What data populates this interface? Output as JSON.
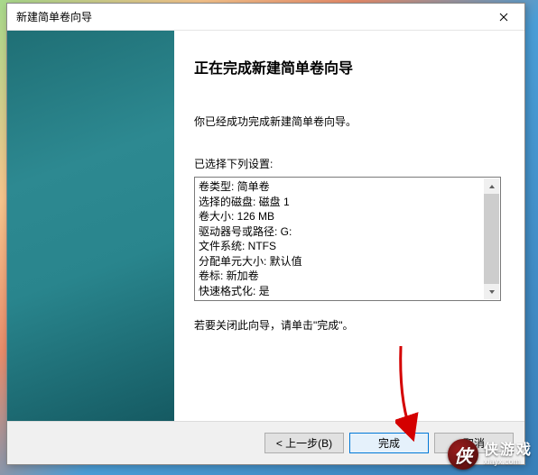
{
  "window": {
    "title": "新建简单卷向导"
  },
  "wizard": {
    "heading": "正在完成新建简单卷向导",
    "description": "你已经成功完成新建简单卷向导。",
    "settings_label": "已选择下列设置:",
    "settings": [
      "卷类型: 简单卷",
      "选择的磁盘: 磁盘 1",
      "卷大小: 126 MB",
      "驱动器号或路径: G:",
      "文件系统: NTFS",
      "分配单元大小: 默认值",
      "卷标: 新加卷",
      "快速格式化: 是"
    ],
    "close_hint": "若要关闭此向导，请单击\"完成\"。"
  },
  "buttons": {
    "back": "< 上一步(B)",
    "finish": "完成",
    "cancel": "取消"
  },
  "watermark": {
    "brand_zh": "侠游戏",
    "brand_en": "xiayx.com",
    "logo_glyph": "侠"
  }
}
